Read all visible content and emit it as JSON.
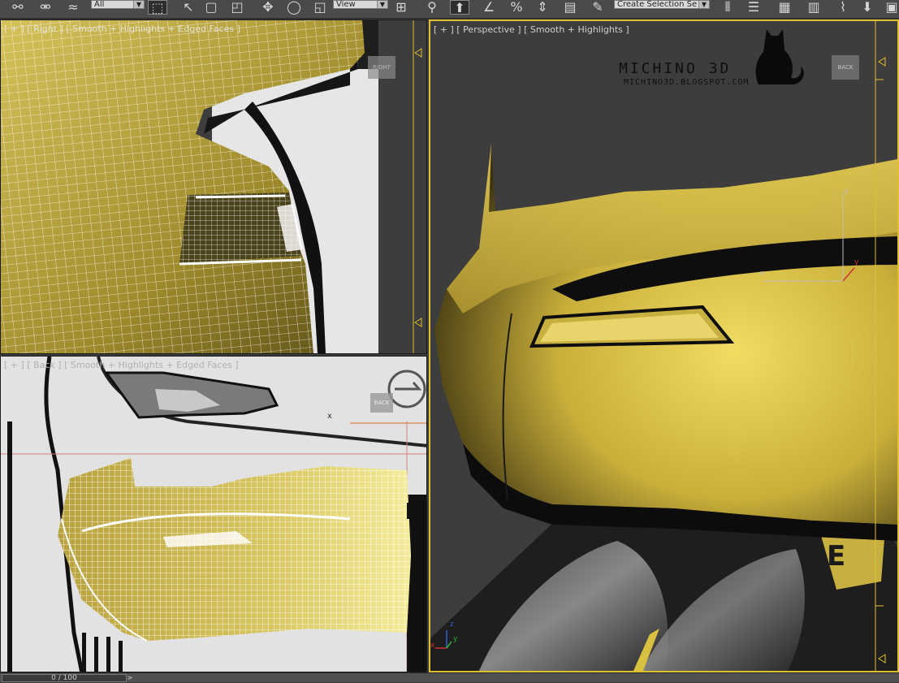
{
  "toolbar": {
    "selection_filter": "All",
    "reference_coord": "View",
    "named_selection_set": "Create Selection Se",
    "icons": [
      "link-icon",
      "unlink-icon",
      "bind-spacewarp-icon",
      "select-object-icon",
      "select-by-name-icon",
      "rect-selection-icon",
      "window-crossing-icon",
      "select-move-icon",
      "select-rotate-icon",
      "select-scale-icon",
      "use-pivot-icon",
      "keyboard-shortcut-icon",
      "snaps-toggle-icon",
      "angle-snap-icon",
      "percent-snap-icon",
      "spinner-snap-icon",
      "edit-named-sets-icon",
      "mirror-icon",
      "align-icon",
      "layer-manager-icon",
      "graphite-ribbon-icon",
      "curve-editor-icon",
      "schematic-view-icon",
      "material-editor-icon",
      "render-setup-icon",
      "render-icon"
    ]
  },
  "viewports": {
    "right": {
      "label": "[ + ] [ Right ] [ Smooth + Highlights + Edged Faces ]",
      "viewcube_label": "RIGHT"
    },
    "back": {
      "label": "[ + ] [ Back ] [ Smooth + Highlights + Edged Faces ]",
      "viewcube_label": "BACK",
      "axis_label": "x"
    },
    "perspective": {
      "label": "[ + ] [ Perspective ] [ Smooth + Highlights ]",
      "viewcube_label": "BACK",
      "watermark_title": "MICHINO 3D",
      "watermark_url": "MICHINO3D.BLOGSPOT.COM",
      "gizmo": {
        "z": "z",
        "x": "x",
        "y": "y"
      },
      "corner_axes": {
        "z": "z",
        "x": "x",
        "y": "y"
      }
    }
  },
  "timeline": {
    "frame_display": "0 / 100",
    "next_label": ">"
  },
  "colors": {
    "active_border": "#e0c030",
    "viewport_border": "#1a1a1a",
    "car_paint": "#c9b24a",
    "wire": "#ffffff",
    "viewport_bg": "#3d3d3d"
  }
}
